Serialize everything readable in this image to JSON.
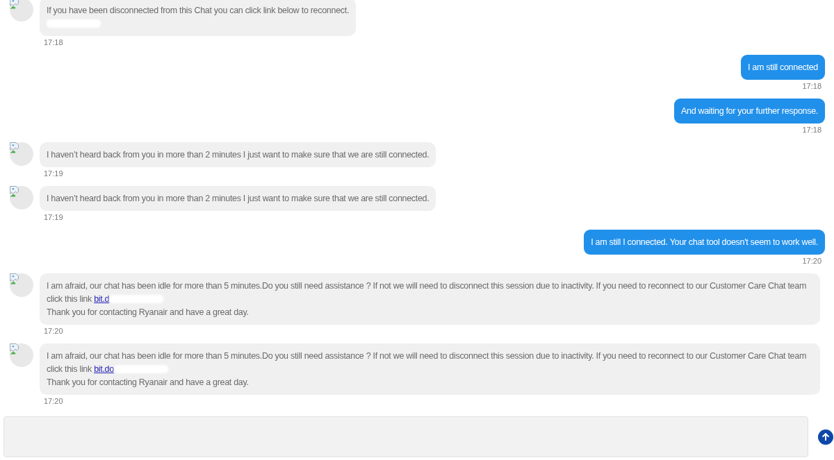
{
  "messages": [
    {
      "kind": "agent",
      "paragraphs": [
        {
          "text": "If you have been disconnected from this Chat you can click link below to reconnect.",
          "blurred": false
        },
        {
          "blurred": true
        }
      ],
      "time": "17:18"
    },
    {
      "kind": "user",
      "paragraphs": [
        {
          "text": "I am still connected",
          "blurred": false
        }
      ],
      "time": "17:18"
    },
    {
      "kind": "user",
      "paragraphs": [
        {
          "text": "And waiting for your further response.",
          "blurred": false
        }
      ],
      "time": "17:18"
    },
    {
      "kind": "agent",
      "paragraphs": [
        {
          "text": "I haven’t heard back from you in more than 2 minutes I just want to make sure that we are still connected.",
          "blurred": false
        }
      ],
      "time": "17:19"
    },
    {
      "kind": "agent",
      "paragraphs": [
        {
          "text": "I haven’t heard back from you in more than 2 minutes I just want to make sure that we are still connected.",
          "blurred": false
        }
      ],
      "time": "17:19"
    },
    {
      "kind": "user",
      "paragraphs": [
        {
          "text": "I am still I connected. Your chat tool doesn't seem to work well.",
          "blurred": false
        }
      ],
      "time": "17:20"
    },
    {
      "kind": "agent",
      "paragraphs": [
        {
          "text": "I am afraid, our chat has been idle for more than 5 minutes.Do you still need assistance ? If not we will need to disconnect this session due to inactivity. If you need to reconnect to our Customer Care Chat team click this link ",
          "link": "bit.d",
          "blurred": true
        },
        {
          "text": "Thank you for contacting Ryanair and have a great day.",
          "blurred": false
        }
      ],
      "time": "17:20"
    },
    {
      "kind": "agent",
      "paragraphs": [
        {
          "text": "I am afraid, our chat has been idle for more than 5 minutes.Do you still need assistance ? If not we will need to disconnect this session due to inactivity. If you need to reconnect to our Customer Care Chat team click this link ",
          "link": "bit.do",
          "blurred": true
        },
        {
          "text": "Thank you for contacting Ryanair and have a great day.",
          "blurred": false
        }
      ],
      "time": "17:20"
    }
  ]
}
